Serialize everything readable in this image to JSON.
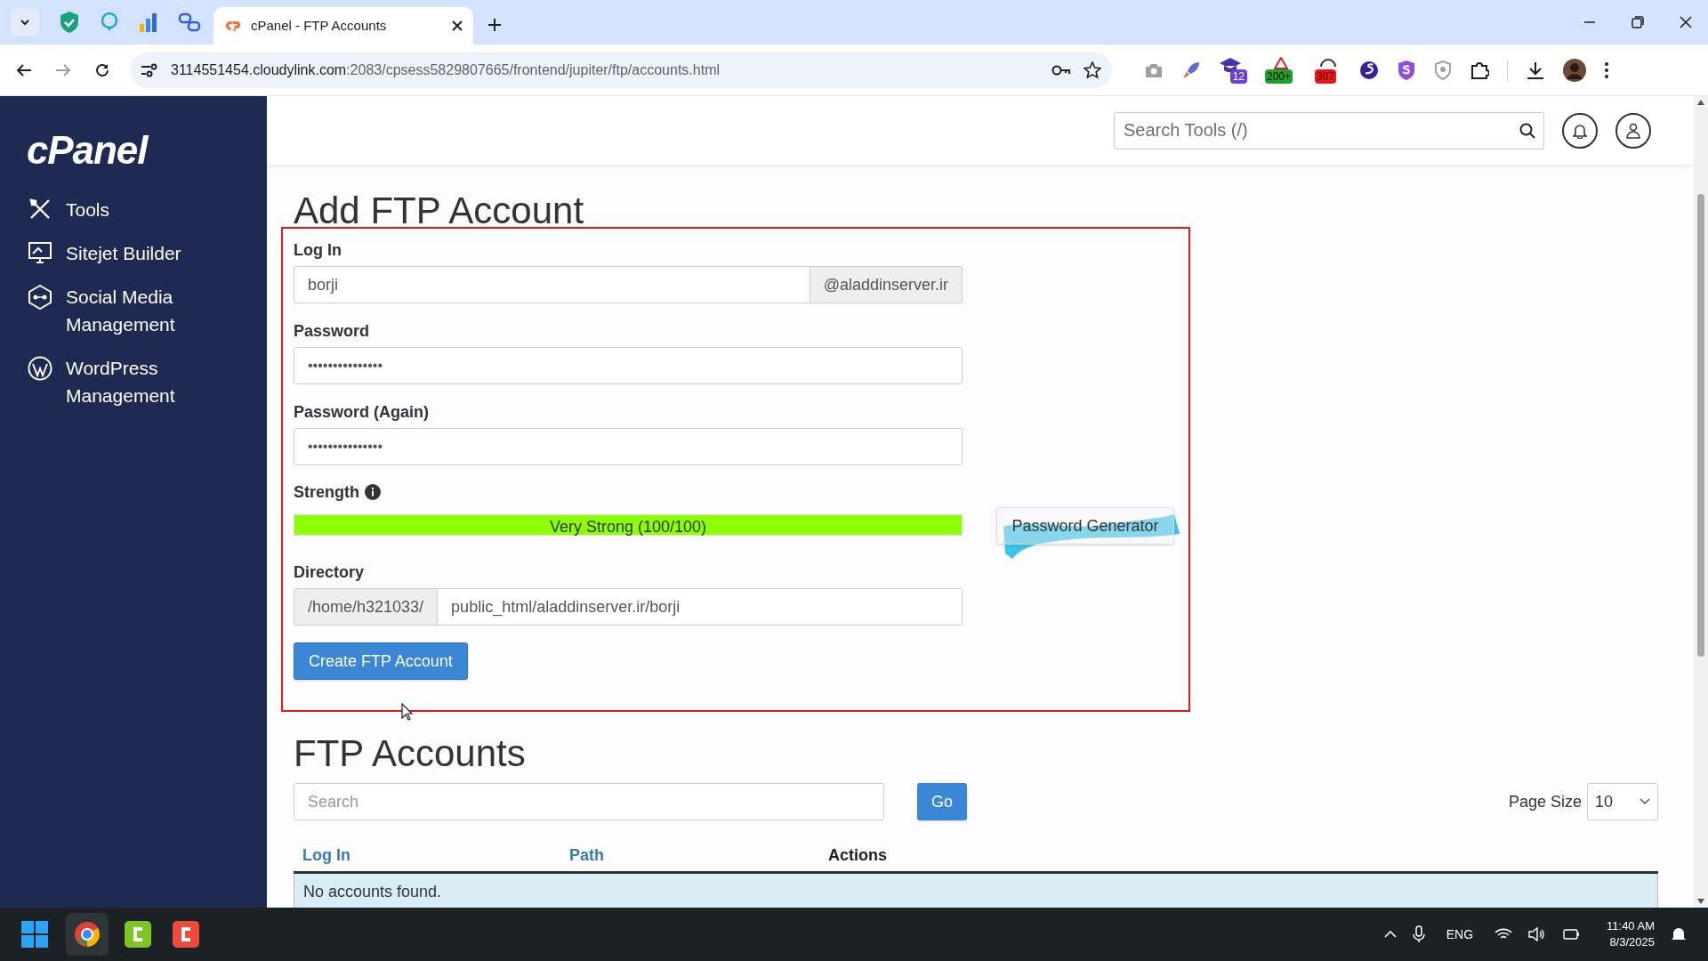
{
  "browser": {
    "tab": {
      "title": "cPanel - FTP Accounts",
      "selected": true
    },
    "url_host": "3114551454.cloudylink.com",
    "url_rest": ":2083/cpsess5829807665/frontend/jupiter/ftp/accounts.html",
    "extension_badges": [
      "12",
      "200+",
      "307"
    ]
  },
  "sidebar": {
    "logo": "cPanel",
    "items": [
      {
        "label": "Tools",
        "kind": "tools"
      },
      {
        "label": "Sitejet Builder",
        "kind": "monitor"
      },
      {
        "label": "Social Media Management",
        "kind": "social"
      },
      {
        "label": "WordPress Management",
        "kind": "wordpress"
      }
    ]
  },
  "header": {
    "search": {
      "placeholder": "Search Tools (/)"
    }
  },
  "add_form": {
    "title": "Add FTP Account",
    "login": {
      "label": "Log In",
      "value": "borji",
      "domain": "@aladdinserver.ir"
    },
    "password": {
      "label": "Password",
      "value": "•••••••••••••••"
    },
    "password_again": {
      "label": "Password (Again)",
      "value": "•••••••••••••••"
    },
    "strength": {
      "label": "Strength",
      "level": 1,
      "reading": "Very Strong (100/100)"
    },
    "generator_button": "Password Generator",
    "directory": {
      "label": "Directory",
      "prefix": "/home/h321033/",
      "value": "public_html/aladdinserver.ir/borji"
    },
    "submit_button": "Create FTP Account"
  },
  "accounts": {
    "title": "FTP Accounts",
    "search": {
      "placeholder": "Search"
    },
    "go_button": "Go",
    "page_size_label": "Page Size",
    "page_size": "10",
    "columns": [
      {
        "label": "Log In",
        "sortable": true
      },
      {
        "label": "Path",
        "sortable": true
      },
      {
        "label": "Actions",
        "sortable": false
      }
    ],
    "empty_message": "No accounts found."
  },
  "taskbar": {
    "language": "ENG",
    "time": "11:40 AM",
    "date": "8/3/2025"
  }
}
